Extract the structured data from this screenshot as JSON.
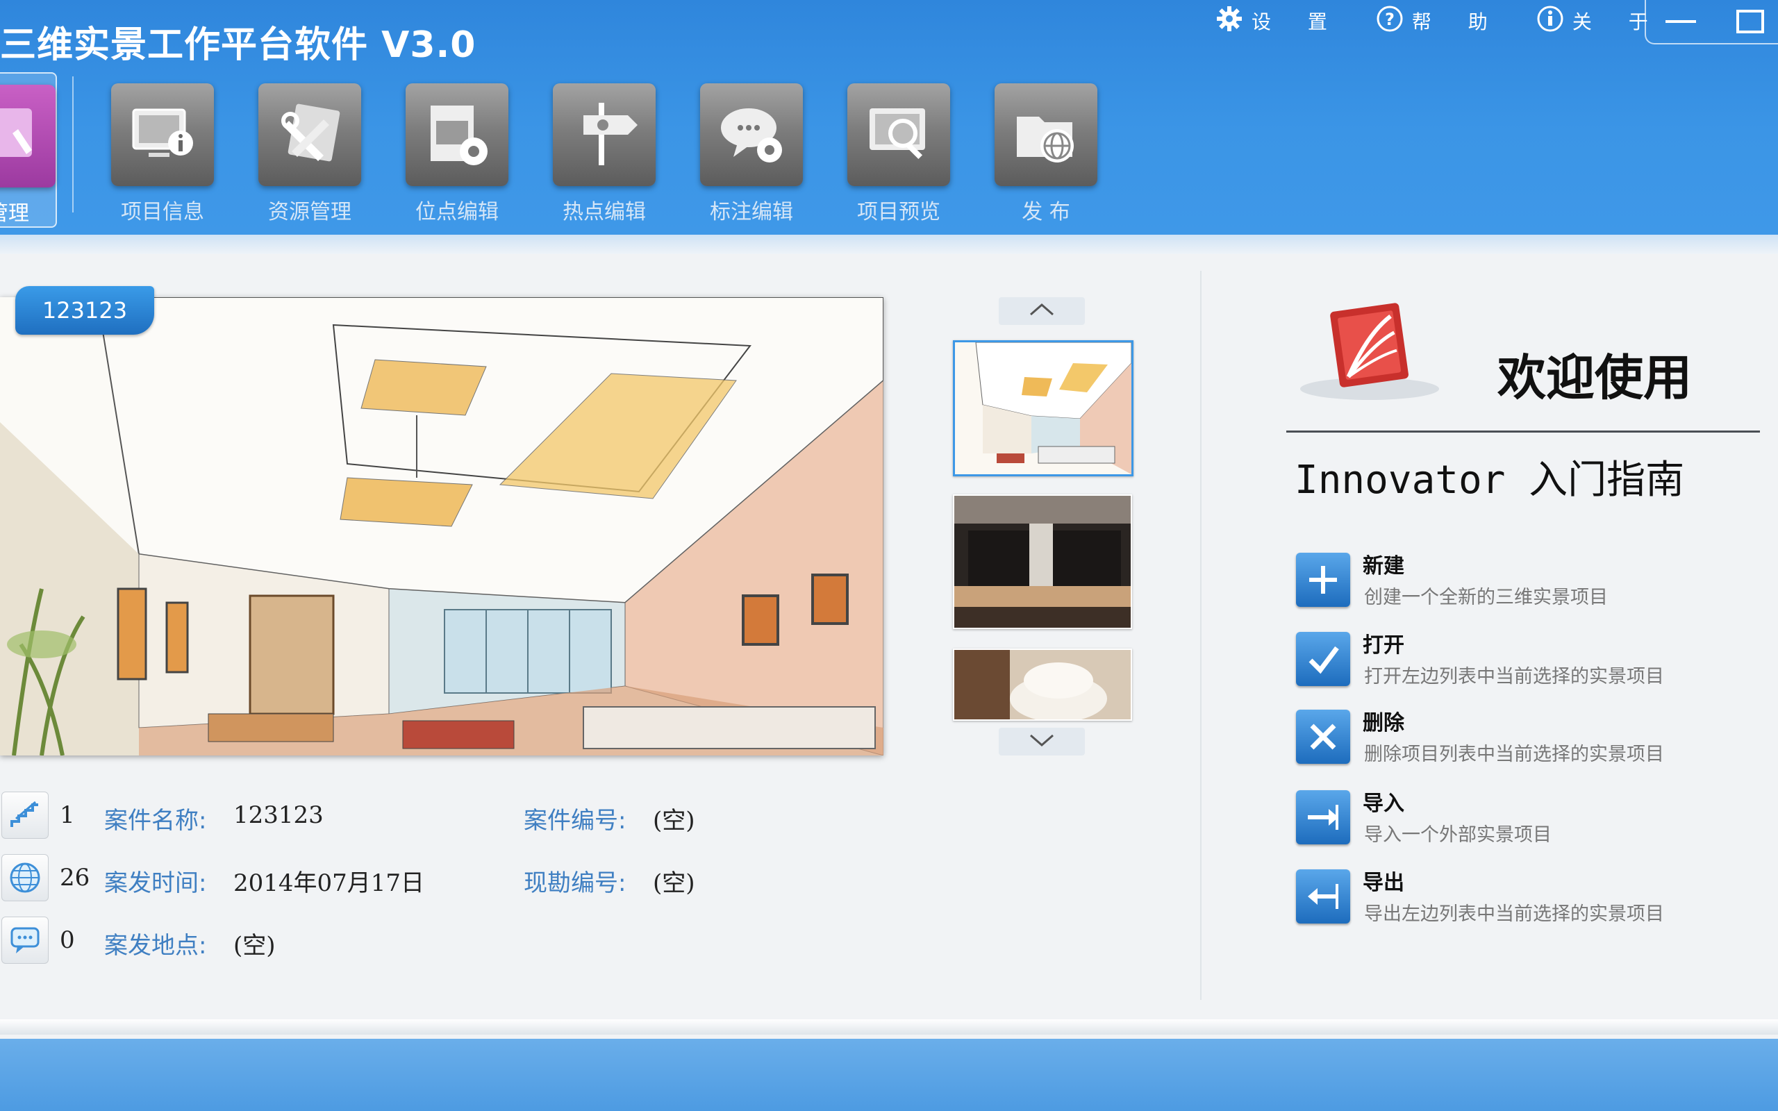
{
  "app": {
    "title": "三维实景工作平台软件 V3.0"
  },
  "top_actions": [
    {
      "label": "设  置",
      "icon": "gear-icon"
    },
    {
      "label": "帮  助",
      "icon": "help-icon"
    },
    {
      "label": "关  于",
      "icon": "info-icon"
    }
  ],
  "toolbar": {
    "active_label": "管理",
    "items": [
      {
        "label": "项目信息",
        "icon": "project-info-icon"
      },
      {
        "label": "资源管理",
        "icon": "resource-manage-icon"
      },
      {
        "label": "位点编辑",
        "icon": "location-edit-icon"
      },
      {
        "label": "热点编辑",
        "icon": "hotspot-edit-icon"
      },
      {
        "label": "标注编辑",
        "icon": "annotation-edit-icon"
      },
      {
        "label": "项目预览",
        "icon": "project-preview-icon"
      },
      {
        "label": "发    布",
        "icon": "publish-icon"
      }
    ]
  },
  "project": {
    "badge": "123123",
    "info": [
      {
        "count": "1",
        "icon": "stairs-icon",
        "left_key": "案件名称:",
        "left_val": "123123",
        "right_key": "案件编号:",
        "right_val": "(空)"
      },
      {
        "count": "26",
        "icon": "globe-icon",
        "left_key": "案发时间:",
        "left_val": "2014年07月17日",
        "right_key": "现勘编号:",
        "right_val": "(空)"
      },
      {
        "count": "0",
        "icon": "comment-icon",
        "left_key": "案发地点:",
        "left_val": "(空)",
        "right_key": "",
        "right_val": ""
      }
    ]
  },
  "guide": {
    "welcome": "欢迎使用",
    "title": "Innovator 入门指南",
    "actions": [
      {
        "title": "新建",
        "desc": "创建一个全新的三维实景项目",
        "icon": "plus-icon"
      },
      {
        "title": "打开",
        "desc": "打开左边列表中当前选择的实景项目",
        "icon": "check-icon"
      },
      {
        "title": "删除",
        "desc": "删除项目列表中当前选择的实景项目",
        "icon": "close-icon"
      },
      {
        "title": "导入",
        "desc": "导入一个外部实景项目",
        "icon": "import-arrow-icon"
      },
      {
        "title": "导出",
        "desc": "导出左边列表中当前选择的实景项目",
        "icon": "export-arrow-icon"
      }
    ]
  },
  "colors": {
    "header": "#3b95e6",
    "accent": "#3d98e6",
    "link_key": "#3f7fc2",
    "active_tool": "#9c3aa0"
  }
}
